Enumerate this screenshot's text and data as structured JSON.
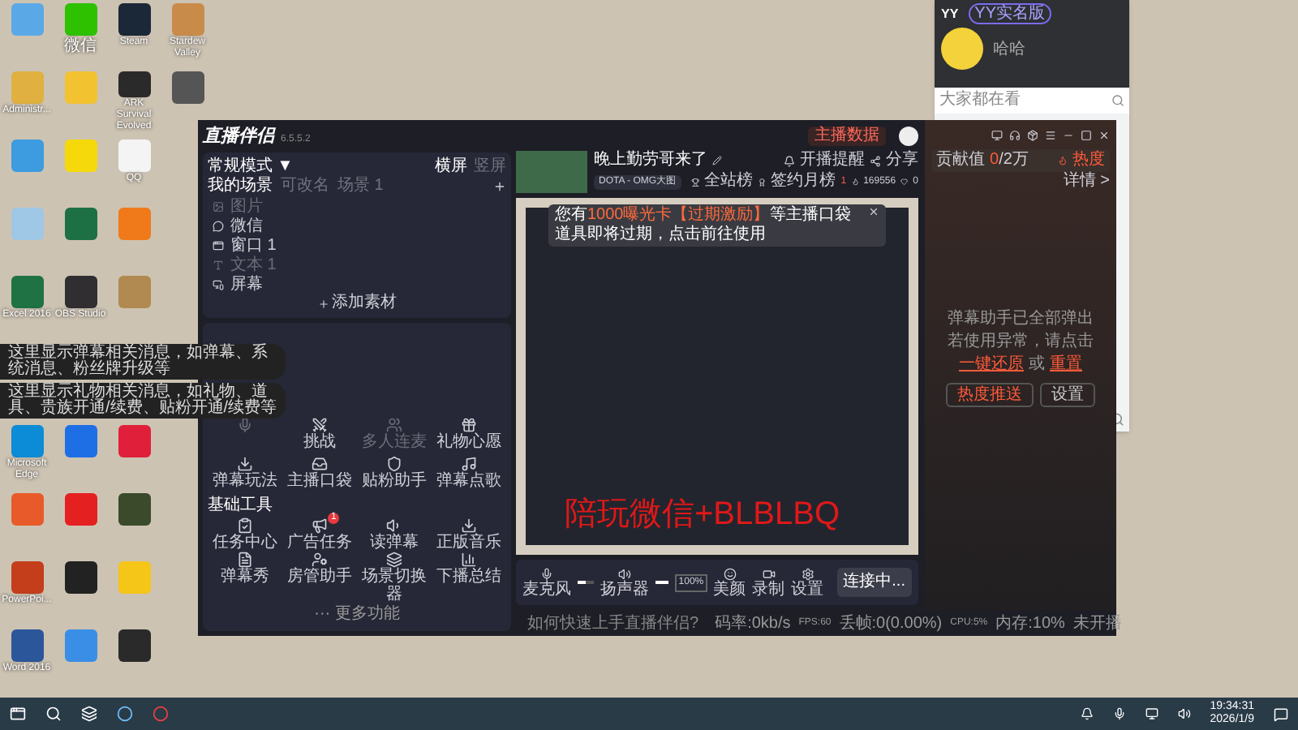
{
  "desktop_rows": [
    [
      {
        "color": "#5aa9e6"
      },
      {
        "label": "微信",
        "color": "#2dc100"
      },
      {
        "label": "Steam",
        "color": "#1b2838"
      },
      {
        "label": "Stardew Valley",
        "color": "#c98b4a"
      }
    ],
    [
      {
        "label": "Administr...",
        "color": "#e0b040"
      },
      {
        "color": "#f2c230"
      },
      {
        "label": "ARK Survival Evolved",
        "color": "#2a2a2a"
      },
      {
        "color": "#555555"
      }
    ],
    [
      {
        "color": "#3d9be0"
      },
      {
        "color": "#f5d90a"
      },
      {
        "label": "QQ",
        "color": "#f4f4f4"
      }
    ],
    [
      {
        "color": "#9fc7e6"
      },
      {
        "color": "#1d7044"
      },
      {
        "color": "#f07a1a"
      }
    ],
    [
      {
        "label": "Excel 2016",
        "color": "#1f7244"
      },
      {
        "label": "OBS Studio",
        "color": "#302e31"
      },
      {
        "color": "#b08a50"
      }
    ]
  ],
  "tooltips": [
    "这里显示弹幕相关消息，如弹幕、系统消息、粉丝牌升级等",
    "这里显示礼物相关消息，如礼物、道具、贵族开通/续费、贴粉开通/续费等"
  ],
  "desktop_rows_below": [
    [
      {
        "label": "Microsoft Edge",
        "color": "#0c8bd6"
      },
      {
        "color": "#1e6fe6"
      },
      {
        "color": "#e0203a"
      }
    ],
    [
      {
        "color": "#e85a2a"
      },
      {
        "color": "#e52020"
      },
      {
        "color": "#3a4a2a"
      }
    ],
    [
      {
        "label": "PowerPoi...",
        "color": "#c43e1c"
      },
      {
        "color": "#222222"
      },
      {
        "color": "#f5c518"
      }
    ],
    [
      {
        "label": "Word 2016",
        "color": "#2b579a"
      },
      {
        "color": "#3a8ee6"
      },
      {
        "color": "#2a2a2a"
      }
    ]
  ],
  "yy": {
    "logo": "YY",
    "badge": "YY实名版",
    "status": "哈哈",
    "search_placeholder": "大家都在看"
  },
  "app": {
    "logo": "直播伴侣",
    "version": "6.5.5.2",
    "mode": "常规模式 ▼",
    "orientation_tabs": [
      {
        "label": "横屏",
        "selected": true
      },
      {
        "label": "竖屏",
        "selected": false
      }
    ],
    "scene_tabs": [
      {
        "label": "我的场景",
        "selected": true
      },
      {
        "label": "可改名",
        "selected": false
      },
      {
        "label": "场景 1",
        "selected": false
      }
    ],
    "sources": [
      {
        "label": "图片",
        "disabled": true
      },
      {
        "label": "微信",
        "disabled": false
      },
      {
        "label": "窗口 1",
        "disabled": false
      },
      {
        "label": "文本 1",
        "disabled": true
      },
      {
        "label": "屏幕",
        "disabled": false
      }
    ],
    "add_source": "添加素材",
    "interactive_tools": [
      {
        "disabled": true
      },
      {
        "label": "挑战",
        "disabled": false
      },
      {
        "label": "多人连麦",
        "disabled": true
      },
      {
        "label": "礼物心愿",
        "disabled": false
      },
      {
        "label": "弹幕玩法",
        "disabled": false
      },
      {
        "label": "主播口袋",
        "disabled": false
      },
      {
        "label": "贴粉助手",
        "disabled": false
      },
      {
        "label": "弹幕点歌",
        "disabled": false
      }
    ],
    "basic_title": "基础工具",
    "basic_tools": [
      {
        "label": "任务中心"
      },
      {
        "label": "广告任务",
        "badge": "1"
      },
      {
        "label": "读弹幕"
      },
      {
        "label": "正版音乐"
      },
      {
        "label": "弹幕秀"
      },
      {
        "label": "房管助手"
      },
      {
        "label": "场景切换器"
      },
      {
        "label": "下播总结"
      }
    ],
    "more": "··· 更多功能",
    "data_button": "主播数据",
    "title": "晚上勤劳哥来了",
    "category": "DOTA - OMG大图",
    "remind": "开播提醒",
    "share": "分享",
    "rank_all": "全站榜",
    "rank_month": "签约月榜",
    "rank_month_value": "1",
    "popularity": "169556",
    "likes": "0",
    "notice": [
      {
        "text": "您有",
        "highlight": false
      },
      {
        "text": "1000曝光卡【过期激励】",
        "highlight": true
      },
      {
        "text": "等主播口袋道具即将过期，点击前往使用",
        "highlight": false
      }
    ],
    "overlay_text": "陪玩微信+BLBLBQ",
    "mic": {
      "label": "麦克风",
      "level": 0.55
    },
    "speaker": {
      "label": "扬声器",
      "level": 1,
      "reading": "100%"
    },
    "actions": [
      "美颜",
      "录制",
      "设置"
    ],
    "connect": "连接中...",
    "help": "如何快速上手直播伴侣?",
    "stats": [
      "码率:0kb/s",
      "FPS:60",
      "丢帧:0(0.00%)",
      "CPU:5%",
      "内存:10%",
      "未开播"
    ],
    "contribution_label": "贡献值",
    "contribution": [
      {
        "text": "0",
        "highlight": true
      },
      {
        "text": "/2万",
        "highlight": false
      }
    ],
    "heat": "热度",
    "details": "详情 >",
    "msg1": "弹幕助手已全部弹出",
    "msg2": "若使用异常，请点击",
    "restore": "一键还原",
    "or": "或",
    "reset": "重置",
    "buttons": [
      {
        "label": "热度推送",
        "primary": true
      },
      {
        "label": "设置",
        "primary": false
      }
    ]
  },
  "taskbar": {
    "time": "19:34:31",
    "date": "2026/1/9"
  }
}
